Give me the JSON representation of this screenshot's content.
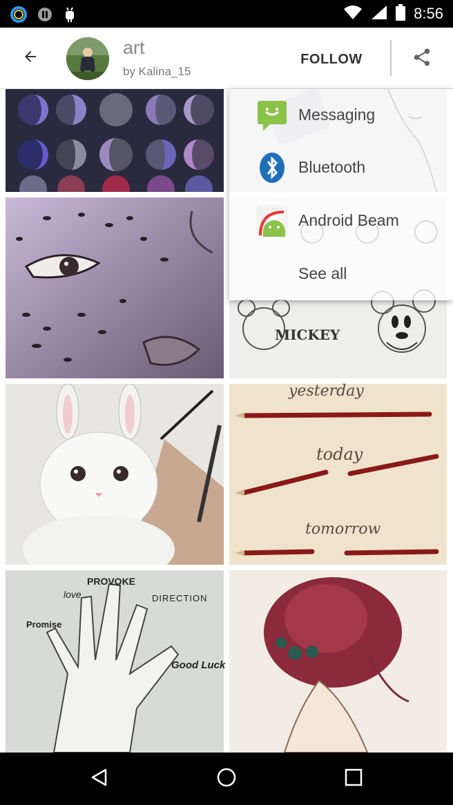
{
  "status_bar": {
    "time": "8:56",
    "icons": [
      "ring-app-icon",
      "pause-icon",
      "android-debug-icon",
      "wifi-icon",
      "signal-icon",
      "battery-icon"
    ]
  },
  "header": {
    "title": "art",
    "subtitle": "by Kalina_15",
    "follow_label": "FOLLOW",
    "icons": [
      "back-arrow-icon",
      "share-icon"
    ]
  },
  "grid": {
    "tiles": [
      {
        "name": "moon-phases"
      },
      {
        "name": "leopard-eye"
      },
      {
        "name": "mickey-sketches"
      },
      {
        "name": "bunny-sketch"
      },
      {
        "name": "yesterday-today-tomorrow"
      },
      {
        "name": "hand-words"
      },
      {
        "name": "girl-bun-sketch"
      }
    ],
    "tile_texts": {
      "mickey_label": "MICKEY",
      "pencils_words": [
        "yesterday",
        "today",
        "tomorrow"
      ],
      "hand_words": [
        "PROVOKE",
        "love",
        "DIRECTION",
        "Promise",
        "Good Luck"
      ]
    }
  },
  "share_popup": {
    "items": [
      {
        "label": "Messaging",
        "icon": "messaging-icon"
      },
      {
        "label": "Bluetooth",
        "icon": "bluetooth-icon"
      },
      {
        "label": "Android Beam",
        "icon": "android-beam-icon"
      },
      {
        "label": "See all",
        "icon": ""
      }
    ]
  },
  "nav_bar": {
    "icons": [
      "back-nav-icon",
      "home-nav-icon",
      "recents-nav-icon"
    ]
  },
  "colors": {
    "status_bar": "#000000",
    "nav_bar": "#000000",
    "follow_text": "#333333",
    "title_text": "#8a8a8a"
  }
}
